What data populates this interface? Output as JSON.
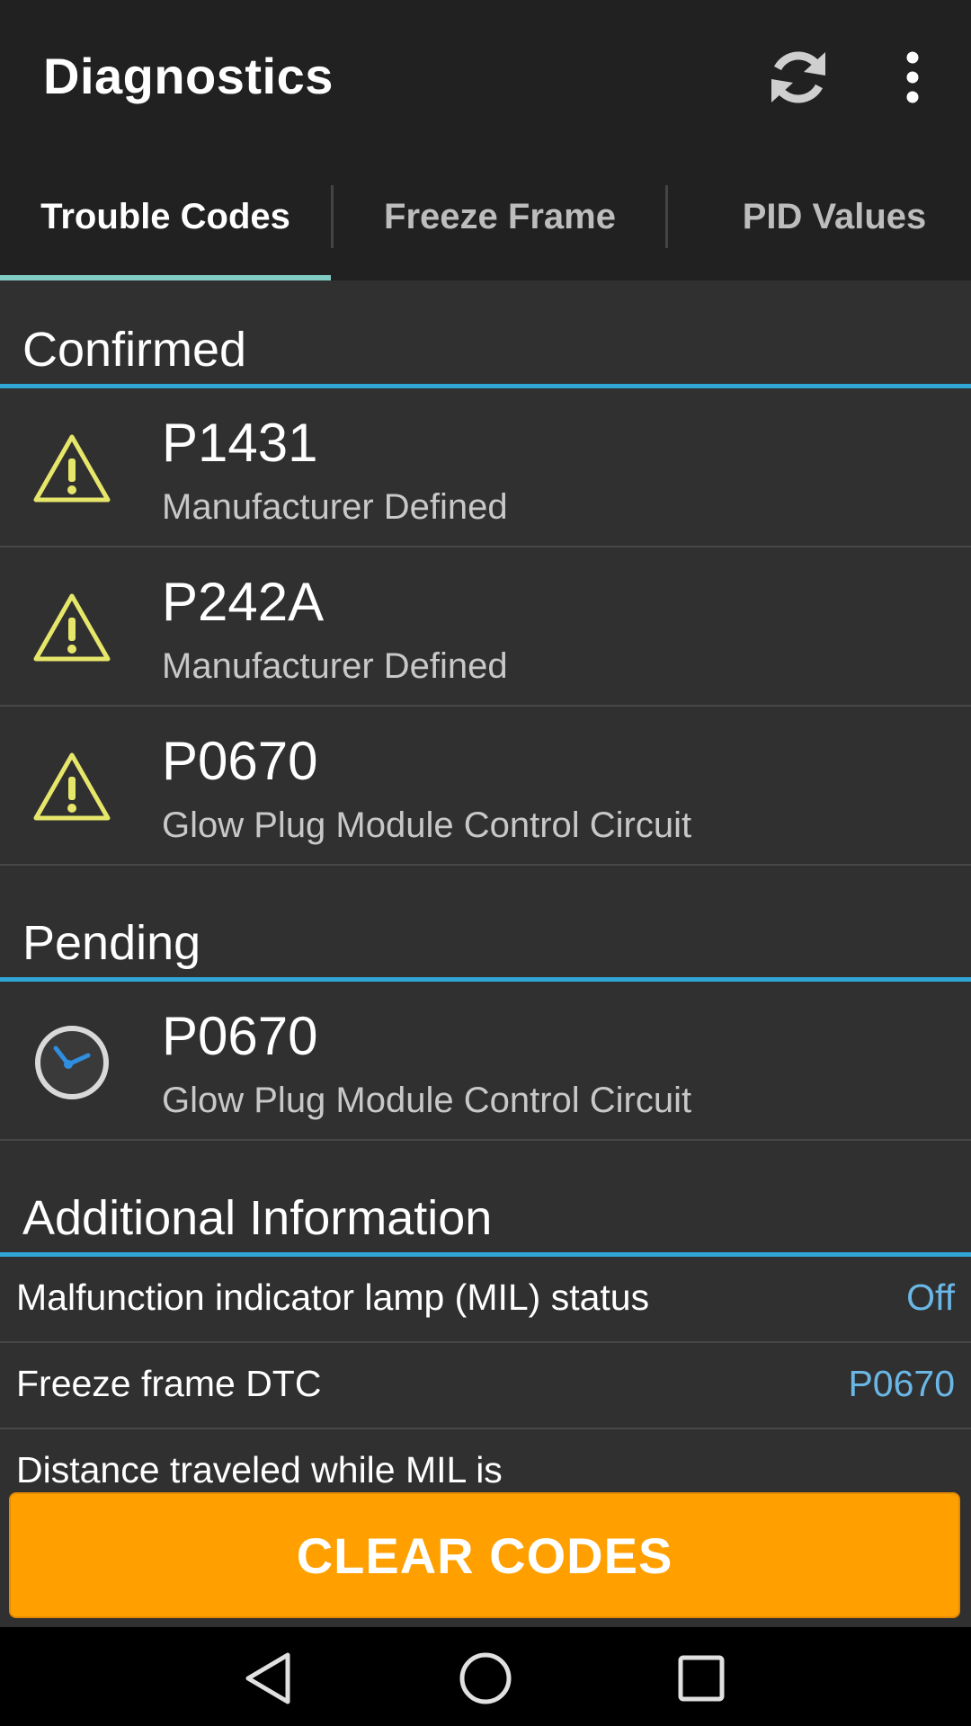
{
  "toolbar": {
    "title": "Diagnostics",
    "icons": [
      "refresh-icon",
      "overflow-menu-icon"
    ]
  },
  "tabs": [
    {
      "label": "Trouble Codes",
      "active": true
    },
    {
      "label": "Freeze Frame",
      "active": false
    },
    {
      "label": "PID Values",
      "active": false
    }
  ],
  "sections": {
    "confirmed": {
      "title": "Confirmed",
      "items": [
        {
          "code": "P1431",
          "description": "Manufacturer Defined",
          "icon": "warning-icon"
        },
        {
          "code": "P242A",
          "description": "Manufacturer Defined",
          "icon": "warning-icon"
        },
        {
          "code": "P0670",
          "description": "Glow Plug Module Control Circuit",
          "icon": "warning-icon"
        }
      ]
    },
    "pending": {
      "title": "Pending",
      "items": [
        {
          "code": "P0670",
          "description": "Glow Plug Module Control Circuit",
          "icon": "clock-icon"
        }
      ]
    },
    "additional": {
      "title": "Additional Information",
      "rows": [
        {
          "label": "Malfunction indicator lamp (MIL) status",
          "value": "Off"
        },
        {
          "label": "Freeze frame DTC",
          "value": "P0670"
        },
        {
          "label": "Distance traveled while MIL is",
          "value": ""
        }
      ]
    }
  },
  "action": {
    "clear_label": "CLEAR CODES"
  },
  "colors": {
    "accent_line": "#2fa6d6",
    "tab_indicator": "#80cbc4",
    "warning": "#e6e66a",
    "value_text": "#6ab7e6",
    "button": "#ffa000"
  },
  "navbar": {
    "icons": [
      "back-icon",
      "home-icon",
      "recents-icon"
    ]
  }
}
